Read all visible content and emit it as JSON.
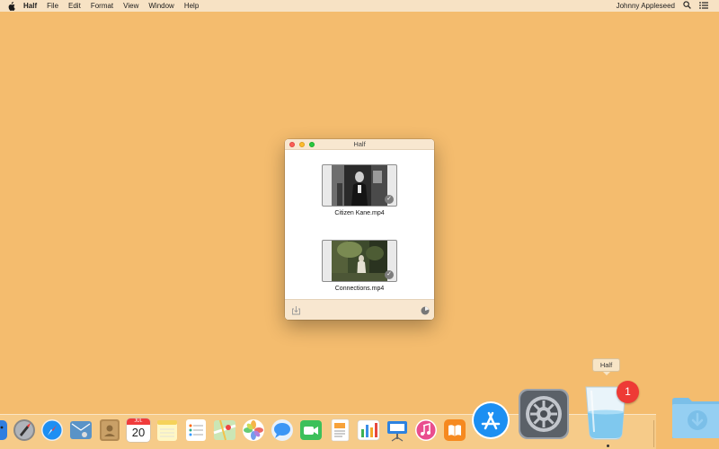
{
  "menubar": {
    "app_name": "Half",
    "items": [
      "File",
      "Edit",
      "Format",
      "View",
      "Window",
      "Help"
    ],
    "user_name": "Johnny Appleseed"
  },
  "window": {
    "title": "Half",
    "videos": [
      {
        "filename": "Citizen Kane.mp4"
      },
      {
        "filename": "Connections.mp4"
      }
    ]
  },
  "dock": {
    "tooltip": "Half",
    "half_badge": "1",
    "calendar_month": "JUL",
    "calendar_day": "20"
  },
  "colors": {
    "desktop": "#f4bc6e",
    "menubar": "#f7e2c4",
    "badge": "#ee3a35"
  }
}
